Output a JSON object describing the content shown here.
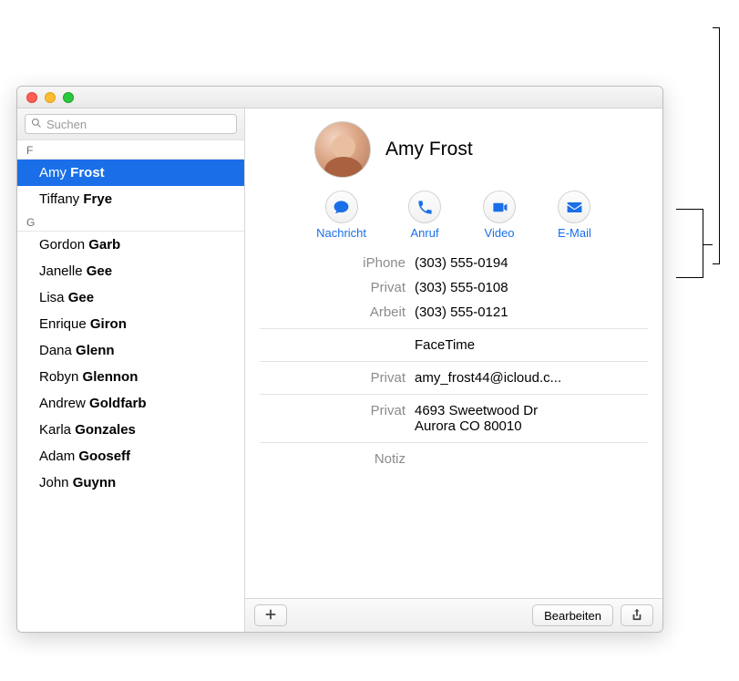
{
  "search": {
    "placeholder": "Suchen"
  },
  "sidebar": {
    "groups": [
      {
        "letter": "F",
        "contacts": [
          {
            "first": "Amy",
            "last": "Frost",
            "selected": true
          },
          {
            "first": "Tiffany",
            "last": "Frye",
            "selected": false
          }
        ]
      },
      {
        "letter": "G",
        "contacts": [
          {
            "first": "Gordon",
            "last": "Garb"
          },
          {
            "first": "Janelle",
            "last": "Gee"
          },
          {
            "first": "Lisa",
            "last": "Gee"
          },
          {
            "first": "Enrique",
            "last": "Giron"
          },
          {
            "first": "Dana",
            "last": "Glenn"
          },
          {
            "first": "Robyn",
            "last": "Glennon"
          },
          {
            "first": "Andrew",
            "last": "Goldfarb"
          },
          {
            "first": "Karla",
            "last": "Gonzales"
          },
          {
            "first": "Adam",
            "last": "Gooseff"
          },
          {
            "first": "John",
            "last": "Guynn"
          }
        ]
      }
    ]
  },
  "detail": {
    "name": "Amy Frost",
    "actions": {
      "message": "Nachricht",
      "call": "Anruf",
      "video": "Video",
      "email": "E-Mail"
    },
    "phones": [
      {
        "label": "iPhone",
        "value": "(303) 555-0194"
      },
      {
        "label": "Privat",
        "value": "(303) 555-0108"
      },
      {
        "label": "Arbeit",
        "value": "(303) 555-0121"
      }
    ],
    "facetime": {
      "label": "",
      "value": "FaceTime"
    },
    "emails": [
      {
        "label": "Privat",
        "value": "amy_frost44@icloud.c..."
      }
    ],
    "addresses": [
      {
        "label": "Privat",
        "value": "4693 Sweetwood Dr\nAurora CO 80010"
      }
    ],
    "note_label": "Notiz"
  },
  "footer": {
    "edit": "Bearbeiten"
  }
}
